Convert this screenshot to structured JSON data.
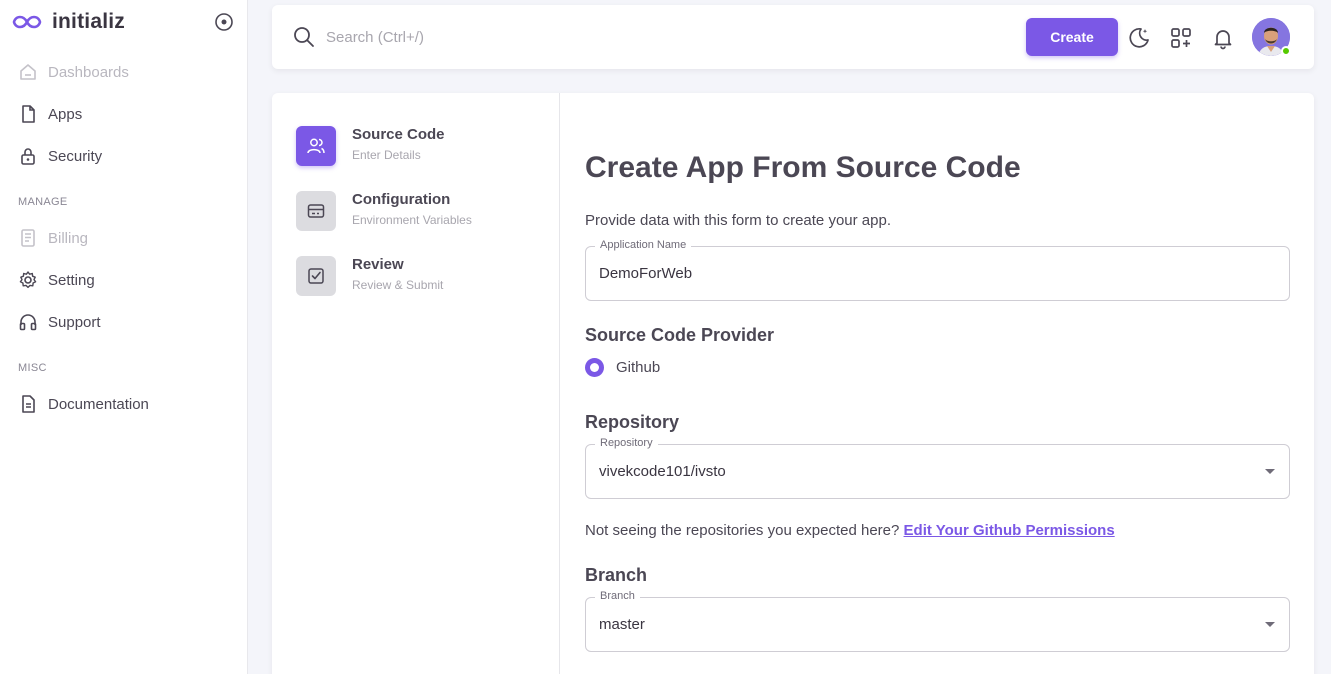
{
  "brand": {
    "name": "initializ"
  },
  "sidebar": {
    "items": [
      {
        "label": "Dashboards",
        "icon": "home-icon",
        "disabled": true
      },
      {
        "label": "Apps",
        "icon": "file-icon"
      },
      {
        "label": "Security",
        "icon": "lock-icon"
      }
    ],
    "manage_section": "MANAGE",
    "manage_items": [
      {
        "label": "Billing",
        "icon": "receipt-icon",
        "disabled": true
      },
      {
        "label": "Setting",
        "icon": "gear-icon"
      },
      {
        "label": "Support",
        "icon": "headphones-icon"
      }
    ],
    "misc_section": "MISC",
    "misc_items": [
      {
        "label": "Documentation",
        "icon": "document-icon"
      }
    ]
  },
  "topbar": {
    "search_placeholder": "Search (Ctrl+/)",
    "create_label": "Create",
    "icons": [
      "theme-toggle-icon",
      "shortcuts-icon",
      "bell-icon"
    ],
    "accent": "#7b58e6"
  },
  "stepper": {
    "steps": [
      {
        "title": "Source Code",
        "subtitle": "Enter Details",
        "icon": "users-icon",
        "active": true
      },
      {
        "title": "Configuration",
        "subtitle": "Environment Variables",
        "icon": "card-icon"
      },
      {
        "title": "Review",
        "subtitle": "Review & Submit",
        "icon": "check-square-icon"
      }
    ]
  },
  "form": {
    "title": "Create App From Source Code",
    "description": "Provide data with this form to create your app.",
    "app_name": {
      "label": "Application Name",
      "value": "DemoForWeb"
    },
    "provider": {
      "heading": "Source Code Provider",
      "option": "Github",
      "selected": true
    },
    "repository": {
      "heading": "Repository",
      "label": "Repository",
      "value": "vivekcode101/ivsto"
    },
    "help": {
      "text": "Not seeing the repositories you expected here? ",
      "link": "Edit Your Github Permissions"
    },
    "branch": {
      "heading": "Branch",
      "label": "Branch",
      "value": "master"
    }
  }
}
